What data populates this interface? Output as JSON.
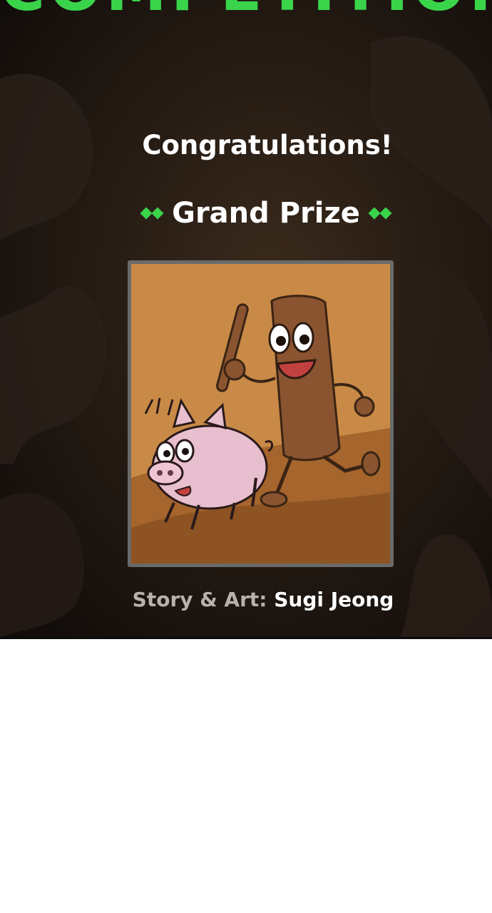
{
  "banner": {
    "headline": "COMPETITION",
    "congrats": "Congratulations!",
    "prize": "Grand Prize",
    "credit_label": "Story & Art:",
    "credit_name": "Sugi Jeong"
  },
  "colors": {
    "accent": "#3ad44a",
    "background": "#17110e",
    "artwork_bg": "#c98a47"
  },
  "artwork": {
    "description_icon": "artwork-image"
  }
}
